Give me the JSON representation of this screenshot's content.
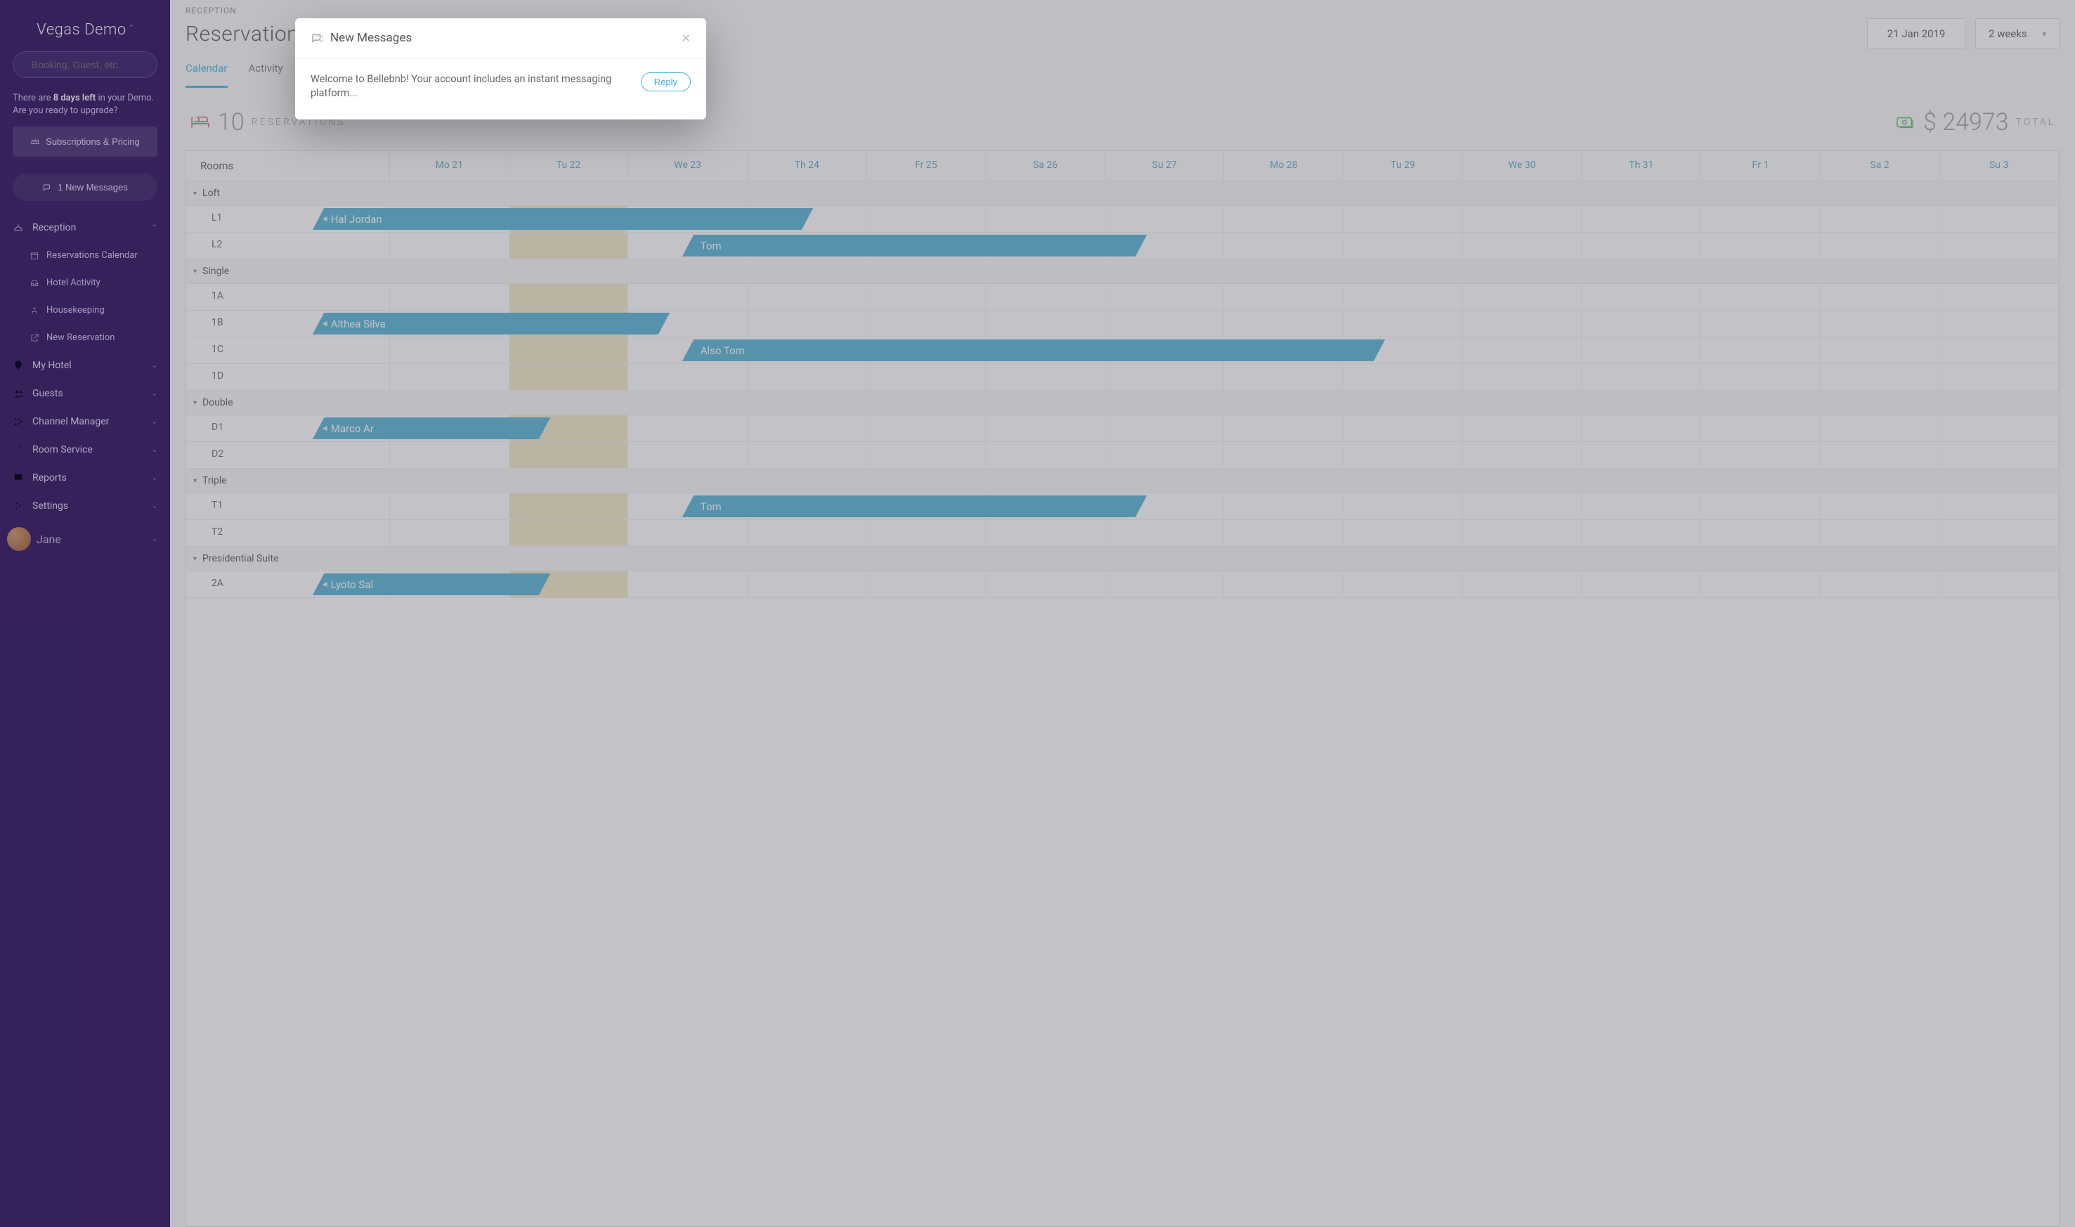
{
  "site_name": "Vegas Demo",
  "search_placeholder": "Booking, Guest, etc.",
  "demo_note_pre": "There are ",
  "demo_note_bold": "8 days left",
  "demo_note_post": " in your Demo. Are you ready to upgrade?",
  "sub_button": "Subscriptions & Pricing",
  "msg_button": "1 New Messages",
  "nav": {
    "reception": "Reception",
    "res_cal": "Reservations Calendar",
    "hotel_activity": "Hotel Activity",
    "housekeeping": "Housekeeping",
    "new_reservation": "New Reservation",
    "my_hotel": "My Hotel",
    "guests": "Guests",
    "channel_manager": "Channel Manager",
    "room_service": "Room Service",
    "reports": "Reports",
    "settings": "Settings"
  },
  "user_name": "Jane",
  "breadcrumb": "RECEPTION",
  "page_title": "Reservations",
  "date_label": "21 Jan 2019",
  "range_label": "2 weeks",
  "tabs": {
    "calendar": "Calendar",
    "activity": "Activity"
  },
  "stats": {
    "count": "10",
    "count_lbl": "RESERVATIONS",
    "total": "$ 24973",
    "total_lbl": "TOTAL"
  },
  "rooms_header": "Rooms",
  "days": [
    "Mo 21",
    "Tu 22",
    "We 23",
    "Th 24",
    "Fr 25",
    "Sa 26",
    "Su 27",
    "Mo 28",
    "Tu 29",
    "We 30",
    "Th 31",
    "Fr 1",
    "Sa 2",
    "Su 3"
  ],
  "groups": [
    {
      "name": "Loft",
      "rooms": [
        {
          "label": "L1",
          "bookings": [
            {
              "guest": "Hal Jordan",
              "start": -0.6,
              "span": 4.1,
              "arrow": true
            }
          ]
        },
        {
          "label": "L2",
          "bookings": [
            {
              "guest": "Tom",
              "start": 2.5,
              "span": 3.8
            }
          ]
        }
      ]
    },
    {
      "name": "Single",
      "rooms": [
        {
          "label": "1A",
          "bookings": []
        },
        {
          "label": "1B",
          "bookings": [
            {
              "guest": "Althea Silva",
              "start": -0.6,
              "span": 2.9,
              "arrow": true
            }
          ]
        },
        {
          "label": "1C",
          "bookings": [
            {
              "guest": "Also Tom",
              "start": 2.5,
              "span": 5.8
            }
          ]
        },
        {
          "label": "1D",
          "bookings": []
        }
      ]
    },
    {
      "name": "Double",
      "rooms": [
        {
          "label": "D1",
          "bookings": [
            {
              "guest": "Marco Ar",
              "start": -0.6,
              "span": 1.9,
              "arrow": true
            }
          ]
        },
        {
          "label": "D2",
          "bookings": []
        }
      ]
    },
    {
      "name": "Triple",
      "rooms": [
        {
          "label": "T1",
          "bookings": [
            {
              "guest": "Tom",
              "start": 2.5,
              "span": 3.8
            }
          ]
        },
        {
          "label": "T2",
          "bookings": []
        }
      ]
    },
    {
      "name": "Presidential Suite",
      "rooms": [
        {
          "label": "2A",
          "bookings": [
            {
              "guest": "Lyoto Sal",
              "start": -0.6,
              "span": 1.9,
              "arrow": true
            }
          ]
        }
      ]
    }
  ],
  "today_index": 1,
  "modal": {
    "title": "New Messages",
    "body": "Welcome to Bellebnb! Your account includes an instant messaging platform...",
    "reply": "Reply"
  }
}
